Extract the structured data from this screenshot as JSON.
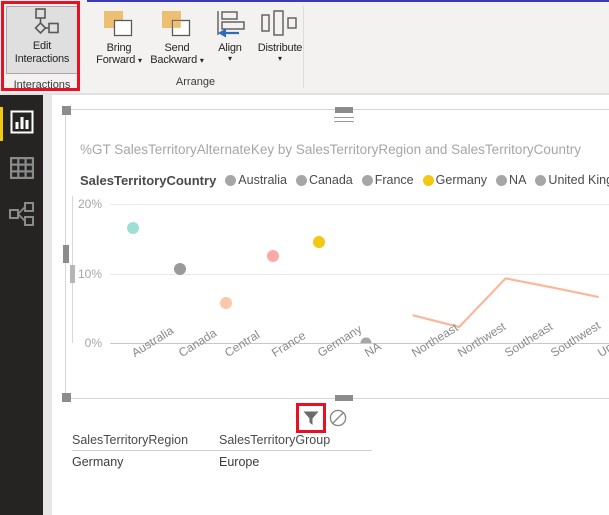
{
  "ribbon": {
    "interactions_group": {
      "label": "Interactions",
      "edit_interactions": {
        "line1": "Edit",
        "line2": "Interactions",
        "icon": "edit-interactions-icon",
        "selected": true,
        "highlight_color": "#e81123"
      }
    },
    "arrange_group": {
      "label": "Arrange",
      "buttons": [
        {
          "line1": "Bring",
          "line2": "Forward",
          "icon": "bring-forward-icon",
          "has_caret": true
        },
        {
          "line1": "Send",
          "line2": "Backward",
          "icon": "send-backward-icon",
          "has_caret": true
        },
        {
          "line1": "Align",
          "line2": "",
          "icon": "align-icon",
          "has_caret": true
        },
        {
          "line1": "Distribute",
          "line2": "",
          "icon": "distribute-icon",
          "has_caret": true
        }
      ]
    }
  },
  "leftnav": {
    "items": [
      {
        "name": "report-view",
        "icon": "bar-chart-icon",
        "active": true
      },
      {
        "name": "data-view",
        "icon": "table-grid-icon",
        "active": false
      },
      {
        "name": "model-view",
        "icon": "relationships-icon",
        "active": false
      }
    ],
    "active_color": "#f2c811"
  },
  "visual": {
    "title": "%GT SalesTerritoryAlternateKey by SalesTerritoryRegion and SalesTerritoryCountry",
    "legend_title": "SalesTerritoryCountry",
    "legend": [
      {
        "label": "Australia",
        "color": "#a6a6a6"
      },
      {
        "label": "Canada",
        "color": "#a6a6a6"
      },
      {
        "label": "France",
        "color": "#a6a6a6"
      },
      {
        "label": "Germany",
        "color": "#f2c811"
      },
      {
        "label": "NA",
        "color": "#a6a6a6"
      },
      {
        "label": "United Kingdom",
        "color": "#a6a6a6"
      }
    ],
    "selected": true
  },
  "filter_toolbar": {
    "filter_icon": "funnel-filter-icon",
    "no_filter_icon": "no-entry-circle-slash-icon",
    "highlight_color": "#e81123"
  },
  "filter_table": {
    "headers": [
      "SalesTerritoryRegion",
      "SalesTerritoryGroup"
    ],
    "rows": [
      [
        "Germany",
        "Europe"
      ]
    ]
  },
  "chart_data": {
    "type": "scatter",
    "title": "%GT SalesTerritoryAlternateKey by SalesTerritoryRegion and SalesTerritoryCountry",
    "xlabel": "",
    "ylabel": "",
    "ylim": [
      0,
      20
    ],
    "ytick_labels": [
      "0%",
      "10%",
      "20%"
    ],
    "ytick_values": [
      0,
      10,
      20
    ],
    "grid": true,
    "legend_position": "top",
    "categories": [
      "Australia",
      "Canada",
      "Central",
      "France",
      "Germany",
      "NA",
      "Northeast",
      "Northwest",
      "Southeast",
      "Southwest",
      "United Kingdom"
    ],
    "points": [
      {
        "x": "Australia",
        "y": 16.5,
        "color": "#9fded4",
        "kind": "dot"
      },
      {
        "x": "Canada",
        "y": 10.6,
        "color": "#9a9a9a",
        "kind": "dot"
      },
      {
        "x": "Central",
        "y": 5.7,
        "color": "#fbc7ab",
        "kind": "dot"
      },
      {
        "x": "France",
        "y": 12.5,
        "color": "#fcaaa6",
        "kind": "dot"
      },
      {
        "x": "Germany",
        "y": 14.5,
        "color": "#f2c811",
        "kind": "dot"
      },
      {
        "x": "NA",
        "y": 0.0,
        "color": "#a6a6a6",
        "kind": "dot"
      },
      {
        "x": "Northeast",
        "y": 4.0,
        "color": "#fcb79b",
        "kind": "line"
      },
      {
        "x": "Northwest",
        "y": 2.3,
        "color": "#fcb79b",
        "kind": "line"
      },
      {
        "x": "Southeast",
        "y": 9.3,
        "color": "#fcb79b",
        "kind": "line"
      },
      {
        "x": "Southwest",
        "y": 8.0,
        "color": "#fcb79b",
        "kind": "line"
      },
      {
        "x": "United Kingdom",
        "y": 6.6,
        "color": "#fcb79b",
        "kind": "line"
      }
    ],
    "line_color": "#fcb79b"
  }
}
